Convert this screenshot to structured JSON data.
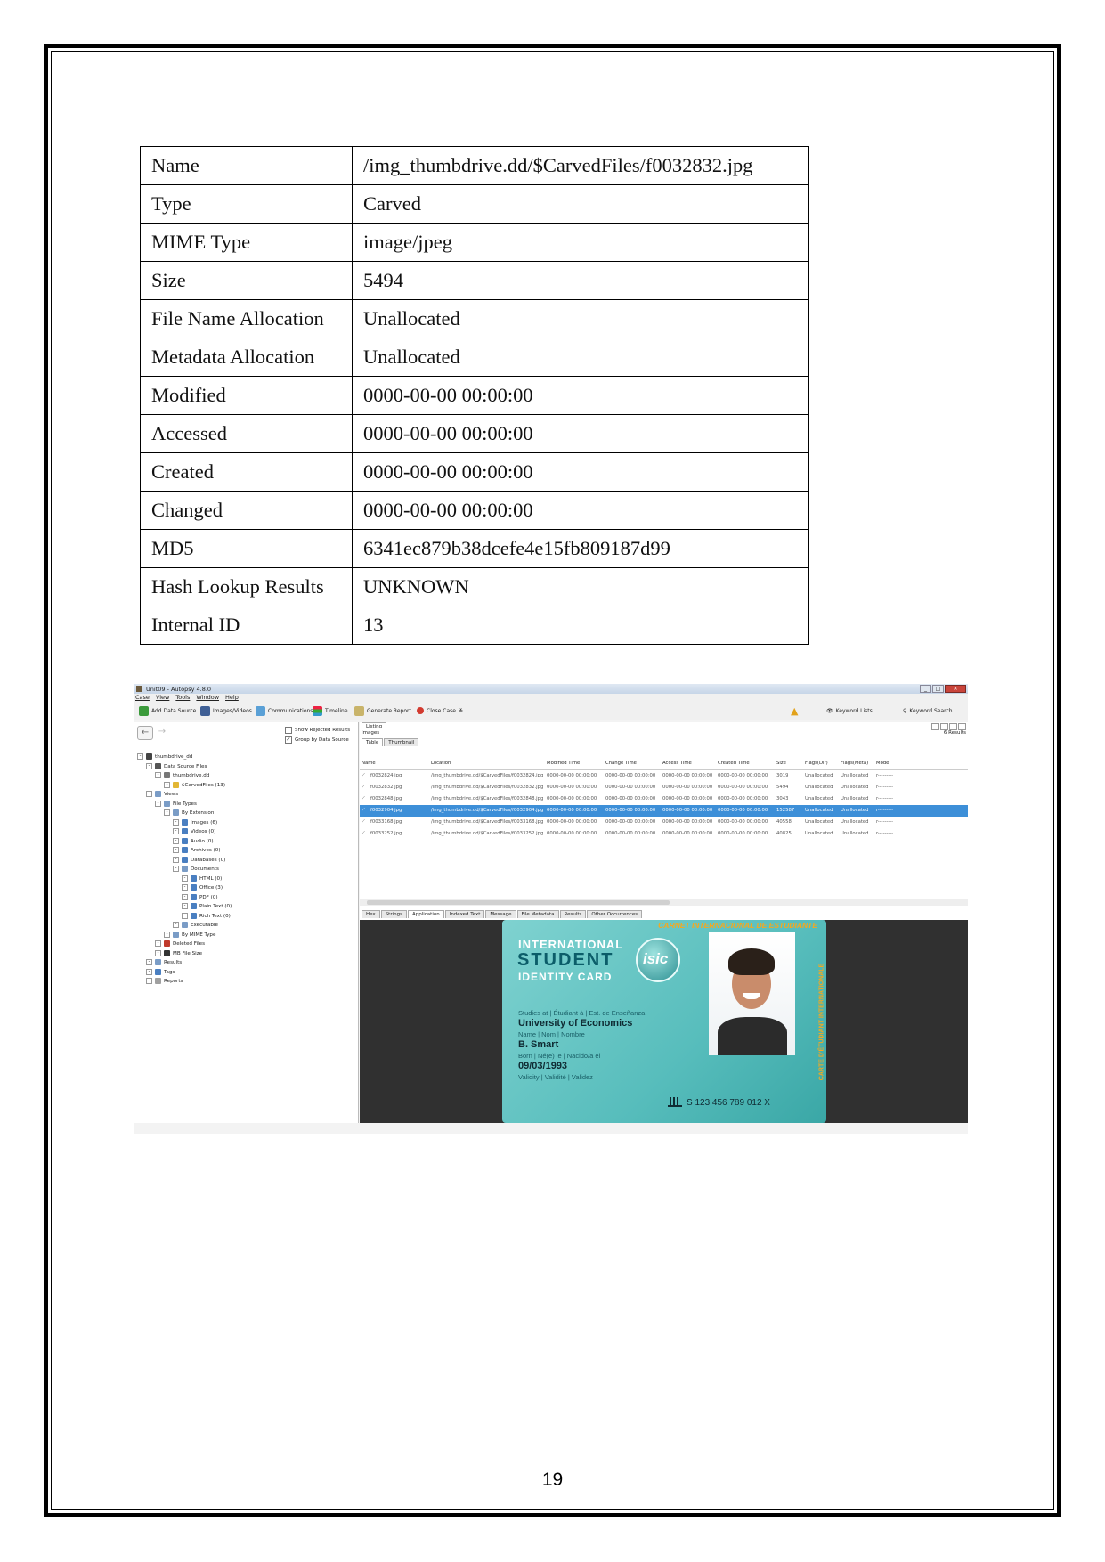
{
  "properties": [
    {
      "key": "Name",
      "value": "/img_thumbdrive.dd/$CarvedFiles/f0032832.jpg"
    },
    {
      "key": "Type",
      "value": "Carved"
    },
    {
      "key": "MIME Type",
      "value": "image/jpeg"
    },
    {
      "key": "Size",
      "value": "5494"
    },
    {
      "key": "File Name Allocation",
      "value": "Unallocated"
    },
    {
      "key": "Metadata Allocation",
      "value": "Unallocated"
    },
    {
      "key": "Modified",
      "value": "0000-00-00 00:00:00"
    },
    {
      "key": "Accessed",
      "value": "0000-00-00 00:00:00"
    },
    {
      "key": "Created",
      "value": "0000-00-00 00:00:00"
    },
    {
      "key": "Changed",
      "value": "0000-00-00 00:00:00"
    },
    {
      "key": "MD5",
      "value": "6341ec879b38dcefe4e15fb809187d99"
    },
    {
      "key": "Hash Lookup Results",
      "value": "UNKNOWN"
    },
    {
      "key": "Internal ID",
      "value": "13"
    }
  ],
  "app": {
    "window_title": "Unit09 - Autopsy 4.8.0",
    "menu": [
      "Case",
      "View",
      "Tools",
      "Window",
      "Help"
    ],
    "toolbar": {
      "add_data_source": "Add Data Source",
      "images_videos": "Images/Videos",
      "communications": "Communications",
      "timeline": "Timeline",
      "generate_report": "Generate Report",
      "close_case": "Close Case",
      "keyword_lists": "Keyword Lists",
      "keyword_search": "Keyword Search"
    },
    "options": {
      "show_rejected": "Show Rejected Results",
      "group_by_source": "Group by Data Source"
    },
    "tree": [
      {
        "label": "thumbdrive_dd",
        "depth": 0,
        "color": "#444"
      },
      {
        "label": "Data Source Files",
        "depth": 1,
        "color": "#555"
      },
      {
        "label": "thumbdrive.dd",
        "depth": 2,
        "color": "#777"
      },
      {
        "label": "$CarvedFiles (13)",
        "depth": 3,
        "color": "#e2b634"
      },
      {
        "label": "Views",
        "depth": 1,
        "color": "#7a9cc6"
      },
      {
        "label": "File Types",
        "depth": 2,
        "color": "#7a9cc6"
      },
      {
        "label": "By Extension",
        "depth": 3,
        "color": "#7a9cc6"
      },
      {
        "label": "Images (6)",
        "depth": 4,
        "color": "#4a7fc1"
      },
      {
        "label": "Videos (0)",
        "depth": 4,
        "color": "#4a7fc1"
      },
      {
        "label": "Audio (0)",
        "depth": 4,
        "color": "#4a7fc1"
      },
      {
        "label": "Archives (0)",
        "depth": 4,
        "color": "#4a7fc1"
      },
      {
        "label": "Databases (0)",
        "depth": 4,
        "color": "#4a7fc1"
      },
      {
        "label": "Documents",
        "depth": 4,
        "color": "#7a9cc6"
      },
      {
        "label": "HTML (0)",
        "depth": 5,
        "color": "#4a7fc1"
      },
      {
        "label": "Office (3)",
        "depth": 5,
        "color": "#4a7fc1"
      },
      {
        "label": "PDF (0)",
        "depth": 5,
        "color": "#4a7fc1"
      },
      {
        "label": "Plain Text (0)",
        "depth": 5,
        "color": "#4a7fc1"
      },
      {
        "label": "Rich Text (0)",
        "depth": 5,
        "color": "#4a7fc1"
      },
      {
        "label": "Executable",
        "depth": 4,
        "color": "#7a9cc6"
      },
      {
        "label": "By MIME Type",
        "depth": 3,
        "color": "#7a9cc6"
      },
      {
        "label": "Deleted Files",
        "depth": 2,
        "color": "#c0392b"
      },
      {
        "label": "MB File Size",
        "depth": 2,
        "color": "#333"
      },
      {
        "label": "Results",
        "depth": 1,
        "color": "#7a9cc6"
      },
      {
        "label": "Tags",
        "depth": 1,
        "color": "#4a7fc1"
      },
      {
        "label": "Reports",
        "depth": 1,
        "color": "#a0a0a0"
      }
    ],
    "listing": {
      "header_tab": "Listing",
      "section": "Images",
      "results": "6 Results",
      "view_tabs": [
        "Table",
        "Thumbnail"
      ],
      "columns": [
        "Name",
        "Location",
        "Modified Time",
        "Change Time",
        "Access Time",
        "Created Time",
        "Size",
        "Flags(Dir)",
        "Flags(Meta)",
        "Mode"
      ],
      "rows": [
        [
          "f0032824.jpg",
          "/img_thumbdrive.dd/$CarvedFiles/f0032824.jpg",
          "0000-00-00 00:00:00",
          "0000-00-00 00:00:00",
          "0000-00-00 00:00:00",
          "0000-00-00 00:00:00",
          "3019",
          "Unallocated",
          "Unallocated",
          "r---------"
        ],
        [
          "f0032832.jpg",
          "/img_thumbdrive.dd/$CarvedFiles/f0032832.jpg",
          "0000-00-00 00:00:00",
          "0000-00-00 00:00:00",
          "0000-00-00 00:00:00",
          "0000-00-00 00:00:00",
          "5494",
          "Unallocated",
          "Unallocated",
          "r---------"
        ],
        [
          "f0032848.jpg",
          "/img_thumbdrive.dd/$CarvedFiles/f0032848.jpg",
          "0000-00-00 00:00:00",
          "0000-00-00 00:00:00",
          "0000-00-00 00:00:00",
          "0000-00-00 00:00:00",
          "3043",
          "Unallocated",
          "Unallocated",
          "r---------"
        ],
        [
          "f0032904.jpg",
          "/img_thumbdrive.dd/$CarvedFiles/f0032904.jpg",
          "0000-00-00 00:00:00",
          "0000-00-00 00:00:00",
          "0000-00-00 00:00:00",
          "0000-00-00 00:00:00",
          "152587",
          "Unallocated",
          "Unallocated",
          "r---------"
        ],
        [
          "f0033168.jpg",
          "/img_thumbdrive.dd/$CarvedFiles/f0033168.jpg",
          "0000-00-00 00:00:00",
          "0000-00-00 00:00:00",
          "0000-00-00 00:00:00",
          "0000-00-00 00:00:00",
          "40558",
          "Unallocated",
          "Unallocated",
          "r---------"
        ],
        [
          "f0033252.jpg",
          "/img_thumbdrive.dd/$CarvedFiles/f0033252.jpg",
          "0000-00-00 00:00:00",
          "0000-00-00 00:00:00",
          "0000-00-00 00:00:00",
          "0000-00-00 00:00:00",
          "40825",
          "Unallocated",
          "Unallocated",
          "r---------"
        ]
      ],
      "selected_row": 3
    },
    "content_tabs": [
      "Hex",
      "Strings",
      "Application",
      "Indexed Text",
      "Message",
      "File Metadata",
      "Results",
      "Other Occurrences"
    ],
    "active_content_tab": "Application",
    "card": {
      "banner": "CARNET INTERNACIONAL DE ESTUDIANTE",
      "line1": "INTERNATIONAL",
      "line2": "STUDENT",
      "line3": "IDENTITY CARD",
      "logo": "isic",
      "studies_label": "Studies at | Étudiant à | Est. de Enseñanza",
      "university": "University of Economics",
      "name_label": "Name | Nom | Nombre",
      "name": "B. Smart",
      "born_label": "Born | Né(e) le | Nacido/a el",
      "born": "09/03/1993",
      "validity_label": "Validity | Validité | Validez",
      "number": "S 123 456 789 012 X",
      "side_text": "CARTE D'ÉTUDIANT INTERNATIONALE"
    }
  },
  "page_number": "19"
}
